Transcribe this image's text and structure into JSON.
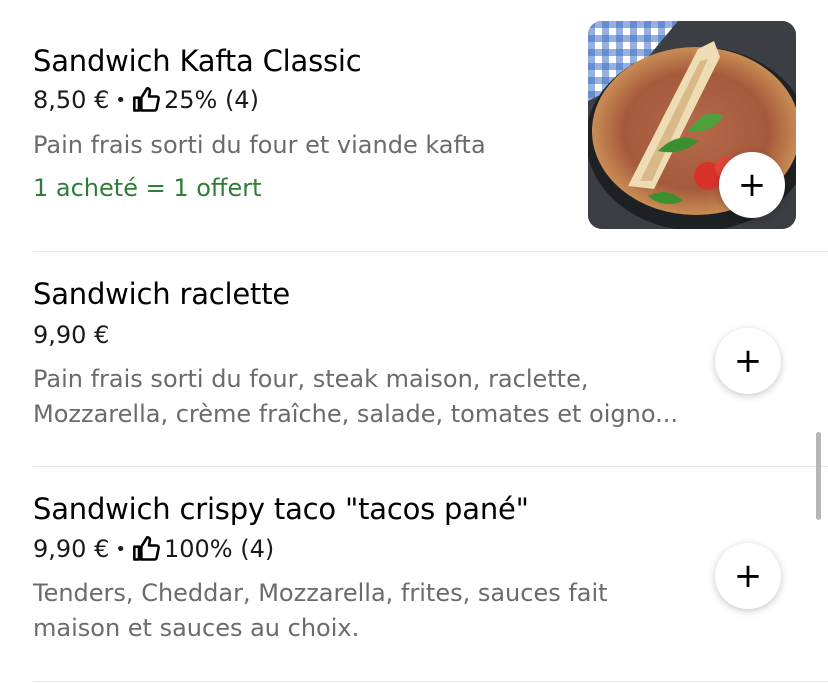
{
  "items": [
    {
      "name": "Sandwich Kafta Classic",
      "price": "8,50 €",
      "separator": "•",
      "rating": "25% (4)",
      "description": "Pain frais sorti du four et viande kafta",
      "promo": "1 acheté = 1 offert",
      "add_label": "+"
    },
    {
      "name": "Sandwich raclette",
      "price": "9,90 €",
      "description_line1": "Pain frais sorti du four, steak maison, raclette,",
      "description_line2": "Mozzarella, crème fraîche, salade, tomates et oigno...",
      "add_label": "+"
    },
    {
      "name": "Sandwich crispy taco \"tacos pané\"",
      "price": "9,90 €",
      "separator": "•",
      "rating": "100% (4)",
      "description_line1": "Tenders, Cheddar, Mozzarella, frites, sauces fait",
      "description_line2": "maison et sauces au choix.",
      "add_label": "+"
    }
  ],
  "icons": {
    "rating": "thumbs-up-icon",
    "add": "plus-icon"
  },
  "colors": {
    "promo": "#2e7d3a",
    "description": "#6b6b6b",
    "divider": "#e8e8e8"
  }
}
